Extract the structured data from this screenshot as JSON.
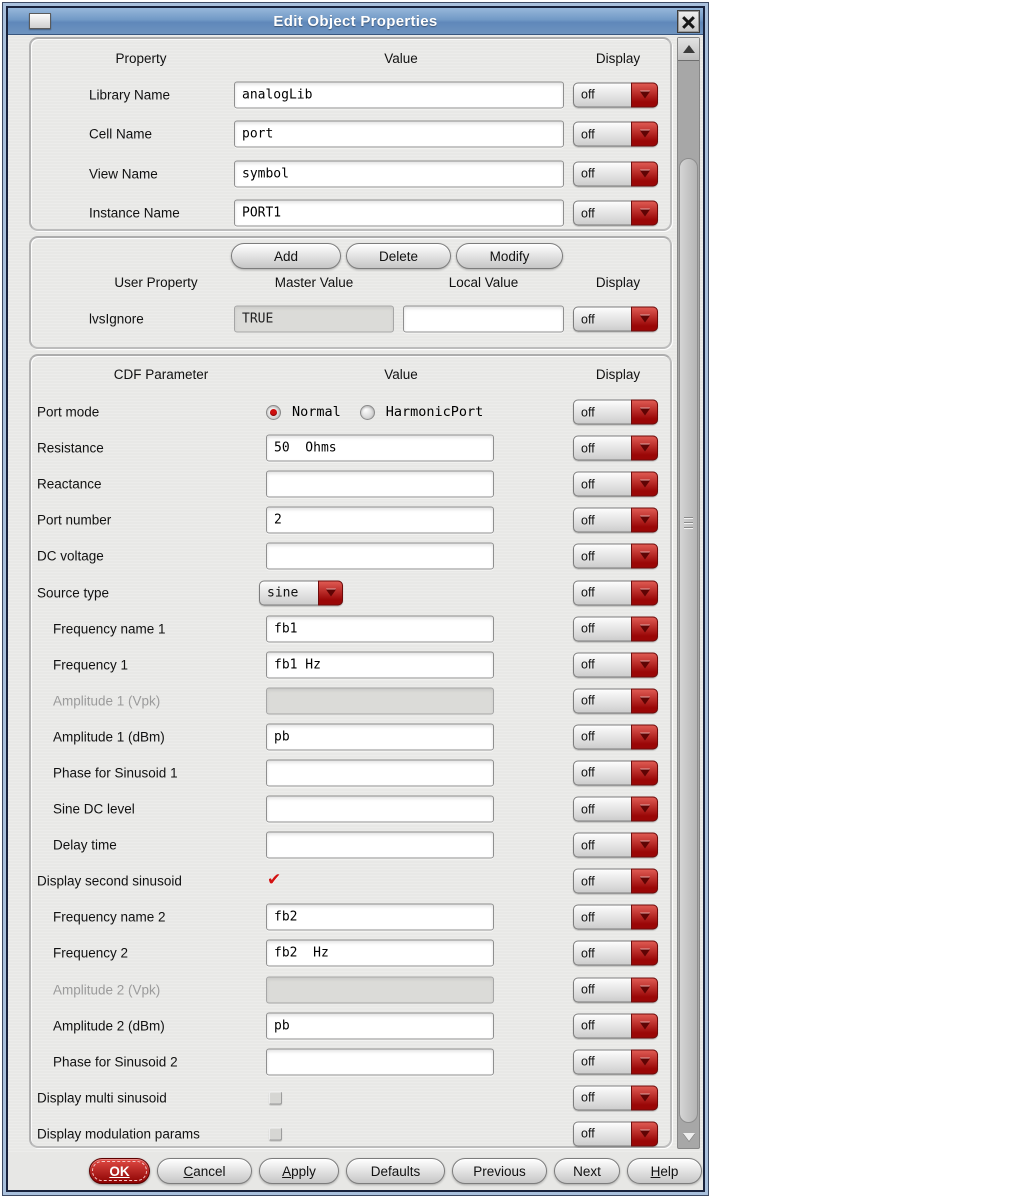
{
  "titlebar": {
    "title": "Edit Object Properties"
  },
  "icons": {
    "close": "✕",
    "check": "✔",
    "dropdown_arrow": "▼",
    "scroll_up": "▲",
    "scroll_down": "▼"
  },
  "colors": {
    "accent_red": "#9a0707",
    "titlebar_blue": "#7199c6",
    "ok_red": "#8c0202"
  },
  "section_properties": {
    "headers": {
      "property": "Property",
      "value": "Value",
      "display": "Display"
    },
    "rows": [
      {
        "label": "Library Name",
        "value": "analogLib",
        "display": "off"
      },
      {
        "label": "Cell Name",
        "value": "port",
        "display": "off"
      },
      {
        "label": "View Name",
        "value": "symbol",
        "display": "off"
      },
      {
        "label": "Instance Name",
        "value": "PORT1",
        "display": "off"
      }
    ]
  },
  "section_user_props": {
    "buttons": [
      {
        "label": "Add"
      },
      {
        "label": "Delete"
      },
      {
        "label": "Modify"
      }
    ],
    "headers": {
      "user_property": "User Property",
      "master_value": "Master Value",
      "local_value": "Local Value",
      "display": "Display"
    },
    "row": {
      "label": "lvsIgnore",
      "master_value": "TRUE",
      "local_value": "",
      "display": "off"
    }
  },
  "section_cdf": {
    "headers": {
      "parameter": "CDF Parameter",
      "value": "Value",
      "display": "Display"
    },
    "rows": [
      {
        "label": "Port mode",
        "type": "radio",
        "options": [
          {
            "label": "Normal",
            "selected": true
          },
          {
            "label": "HarmonicPort",
            "selected": false
          }
        ],
        "display": "off"
      },
      {
        "label": "Resistance",
        "type": "input",
        "value": "50  Ohms",
        "display": "off"
      },
      {
        "label": "Reactance",
        "type": "input",
        "value": "",
        "display": "off"
      },
      {
        "label": "Port number",
        "type": "input",
        "value": "2",
        "display": "off"
      },
      {
        "label": "DC voltage",
        "type": "input",
        "value": "",
        "display": "off"
      },
      {
        "label": "Source type",
        "type": "select",
        "value": "sine",
        "display": "off"
      },
      {
        "label": "Frequency name 1",
        "type": "input",
        "value": "fb1",
        "indent": true,
        "display": "off"
      },
      {
        "label": "Frequency 1",
        "type": "input",
        "value": "fb1 Hz",
        "indent": true,
        "display": "off"
      },
      {
        "label": "Amplitude 1 (Vpk)",
        "type": "input",
        "value": "",
        "indent": true,
        "disabled": true,
        "display": "off"
      },
      {
        "label": "Amplitude 1 (dBm)",
        "type": "input",
        "value": "pb",
        "indent": true,
        "display": "off"
      },
      {
        "label": "Phase for Sinusoid 1",
        "type": "input",
        "value": "",
        "indent": true,
        "display": "off"
      },
      {
        "label": "Sine DC level",
        "type": "input",
        "value": "",
        "indent": true,
        "display": "off"
      },
      {
        "label": "Delay time",
        "type": "input",
        "value": "",
        "indent": true,
        "display": "off"
      },
      {
        "label": "Display second sinusoid",
        "type": "checkbox",
        "checked": true,
        "display": "off"
      },
      {
        "label": "Frequency name 2",
        "type": "input",
        "value": "fb2",
        "indent": true,
        "display": "off"
      },
      {
        "label": "Frequency 2",
        "type": "input",
        "value": "fb2  Hz",
        "indent": true,
        "display": "off"
      },
      {
        "label": "Amplitude 2 (Vpk)",
        "type": "input",
        "value": "",
        "indent": true,
        "disabled": true,
        "display": "off"
      },
      {
        "label": "Amplitude 2 (dBm)",
        "type": "input",
        "value": "pb",
        "indent": true,
        "display": "off"
      },
      {
        "label": "Phase for Sinusoid 2",
        "type": "input",
        "value": "",
        "indent": true,
        "display": "off"
      },
      {
        "label": "Display multi sinusoid",
        "type": "checkbox",
        "checked": false,
        "display": "off"
      },
      {
        "label": "Display modulation params",
        "type": "checkbox",
        "checked": false,
        "display": "off"
      }
    ]
  },
  "footer": {
    "buttons": [
      {
        "pre": "",
        "u": "OK",
        "post": ""
      },
      {
        "pre": "",
        "u": "C",
        "post": "ancel"
      },
      {
        "pre": "",
        "u": "A",
        "post": "pply"
      },
      {
        "pre": "Defaults",
        "u": "",
        "post": ""
      },
      {
        "pre": "Previous",
        "u": "",
        "post": ""
      },
      {
        "pre": "Next",
        "u": "",
        "post": ""
      },
      {
        "pre": "",
        "u": "H",
        "post": "elp"
      }
    ]
  }
}
